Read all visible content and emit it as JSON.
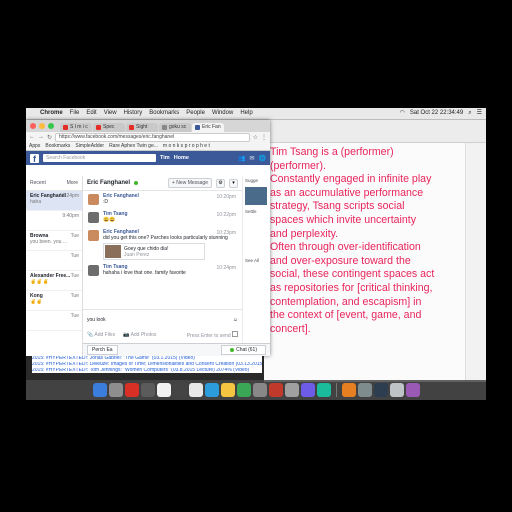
{
  "menubar": {
    "app": "Chrome",
    "items": [
      "File",
      "Edit",
      "View",
      "History",
      "Bookmarks",
      "People",
      "Window",
      "Help"
    ],
    "clock": "Sat Oct 22  22:34:49"
  },
  "chrome": {
    "tabs": [
      {
        "label": "S l m i c",
        "color": "#e52d27"
      },
      {
        "label": "Spec",
        "color": "#e52d27"
      },
      {
        "label": "Sight",
        "color": "#e52d27"
      },
      {
        "label": "goku sc",
        "color": "#888888"
      },
      {
        "label": "Eric Fan",
        "color": "#3b5998"
      }
    ],
    "url": "https://www.facebook.com/messages/eric.fanghanel",
    "bookmarks": [
      "Apps",
      "Bookmarks",
      "SimpleAdder",
      "Rare Aphex Twin ge...",
      "m o n k s  p r o p h e t"
    ]
  },
  "facebook": {
    "search_placeholder": "Search Facebook",
    "user": "Tim",
    "home": "Home",
    "list_header": {
      "left": "Recent",
      "right": "More"
    },
    "conversations": [
      {
        "name": "Eric Fanghanel",
        "snippet": "haha",
        "time": "10:24pm"
      },
      {
        "name": "",
        "snippet": "",
        "time": "9:40pm"
      },
      {
        "name": "Browna",
        "snippet": "you been. you ...",
        "time": "Tue"
      },
      {
        "name": "",
        "snippet": "",
        "time": "Tue"
      },
      {
        "name": "Alexander Free...",
        "snippet": "✌✌✌",
        "time": "Tue"
      },
      {
        "name": "Kong",
        "snippet": "✌✌",
        "time": "Tue"
      },
      {
        "name": "",
        "snippet": "",
        "time": "Tue"
      }
    ],
    "chat_title": "Eric Fanghanel",
    "new_message": "+ New Message",
    "messages": [
      {
        "sender": "Eric Fanghanel",
        "text": ":D",
        "time": "10:20pm",
        "avatar": "#c98b5e"
      },
      {
        "sender": "Tim Tsang",
        "text": "😀😀",
        "time": "10:22pm",
        "avatar": "#6d6d6d"
      },
      {
        "sender": "Eric Fanghanel",
        "text": "did you get this one? Parches looks particularly stunning",
        "time": "10:23pm",
        "avatar": "#c98b5e"
      },
      {
        "sender": "Tim Tsang",
        "text": "hahaha i love that one. family favorite",
        "time": "10:24pm",
        "avatar": "#6d6d6d"
      }
    ],
    "link_card": {
      "title": "Goey que chido dia!",
      "source": "Juan Perez"
    },
    "compose_value": "you look",
    "add_files": "Add Files",
    "add_photos": "Add Photos",
    "press_enter": "Press Enter to send",
    "right_col": {
      "label1": "Sugge",
      "label2": "Settle",
      "label3": "See All"
    },
    "dock_tab": "Perch Ea",
    "chat_label": "Chat (61)"
  },
  "editor": {
    "paragraphs": [
      "Tim Tsang is a (performer)",
      "(performer).",
      "Constantly engaged in infinite play",
      "as an accumulative performance",
      "strategy, Tsang scripts social",
      "spaces which invite uncertainty",
      "and perplexity.",
      "Often through over-identification",
      "and over-exposure toward the",
      "social, these contingent spaces act",
      "as repositories for [critical thinking,",
      "contemplation, and escapism] in",
      "the context of [event, game, and",
      "concert]."
    ]
  },
  "desktop_links": [
    "2015: #HYPERTEXTED!: Jonas Gabriel: \"The Game\" (03.1.2015) (Video)",
    "2015: #HYPERTEXTED!: Deleuze: Images of Time; Dimensionalities and Consent Creation (03.13.2015)",
    "2015: #HYPERTEXTED!: Tom Jennings: \"Women Computers\" (03.8.2015 Lecture) 2074% (Video)"
  ],
  "dock_colors": [
    "#3b7ddd",
    "#8e8e8e",
    "#d93025",
    "#5b5b5b",
    "#f2f2f2",
    "#444444",
    "#e8e8e8",
    "#2d9cdb",
    "#f5c542",
    "#3aa757",
    "#888888",
    "#c0392b",
    "#a0a0a0",
    "#6c5ce7",
    "#1abc9c",
    "#e67e22",
    "#7f8c8d",
    "#2c3e50",
    "#bdc3c7",
    "#9b59b6"
  ],
  "colors": {
    "fb_blue": "#3b5998",
    "editor_pink": "#e8245d"
  }
}
